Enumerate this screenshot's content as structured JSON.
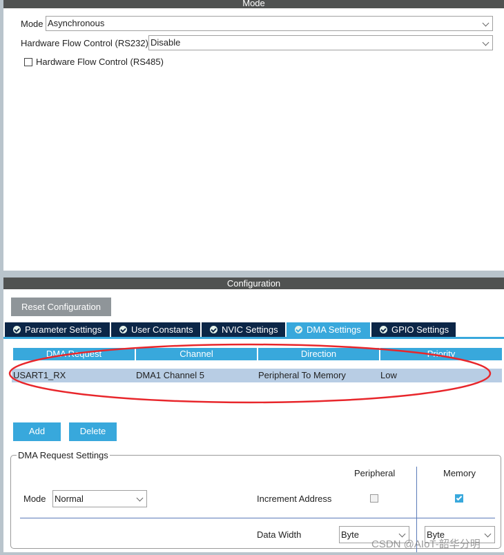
{
  "mode_section": {
    "title": "Mode",
    "mode_label": "Mode",
    "mode_value": "Asynchronous",
    "rs232_label": "Hardware Flow Control (RS232)",
    "rs232_value": "Disable",
    "rs485_label": "Hardware Flow Control (RS485)",
    "rs485_checked": false
  },
  "config": {
    "title": "Configuration",
    "reset_label": "Reset Configuration",
    "tabs": [
      {
        "label": "Parameter Settings"
      },
      {
        "label": "User Constants"
      },
      {
        "label": "NVIC Settings"
      },
      {
        "label": "DMA Settings",
        "active": true
      },
      {
        "label": "GPIO Settings"
      }
    ],
    "table": {
      "headers": [
        "DMA Request",
        "Channel",
        "Direction",
        "Priority"
      ],
      "rows": [
        [
          "USART1_RX",
          "DMA1 Channel 5",
          "Peripheral To Memory",
          "Low"
        ]
      ]
    },
    "add_label": "Add",
    "delete_label": "Delete",
    "request_settings": {
      "title": "DMA Request Settings",
      "mode_label": "Mode",
      "mode_value": "Normal",
      "peripheral_label": "Peripheral",
      "memory_label": "Memory",
      "increment_label": "Increment Address",
      "peripheral_increment": false,
      "memory_increment": true,
      "data_width_label": "Data Width",
      "peripheral_width": "Byte",
      "memory_width": "Byte"
    }
  },
  "annotation_color": "#e8262b",
  "watermark": "CSDN @AIoT-韶华分明"
}
